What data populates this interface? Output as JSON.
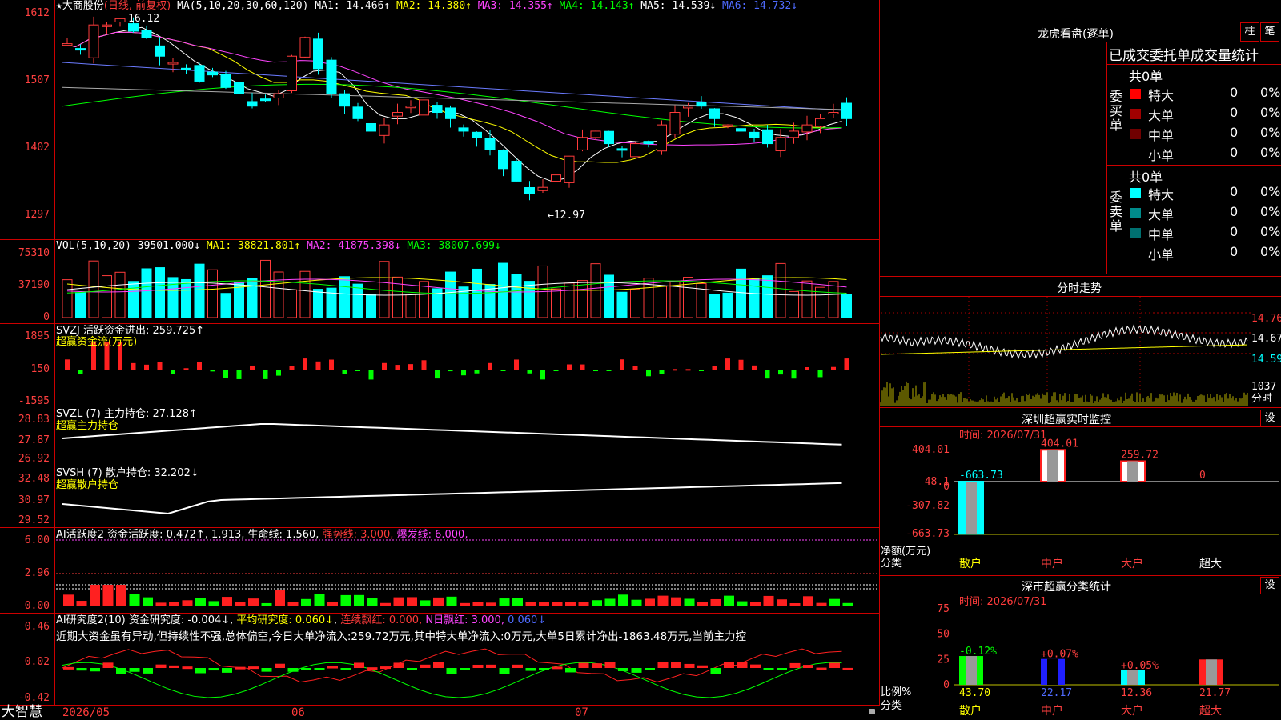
{
  "header": {
    "star": "★",
    "stock_name": "大商股份",
    "period": "(日线, 前复权)",
    "ma_label": "MA(5,10,20,30,60,120)",
    "ma1": "MA1: 14.466↑",
    "ma2": "MA2: 14.380↑",
    "ma3": "MA3: 14.355↑",
    "ma4": "MA4: 14.143↑",
    "ma5": "MA5: 14.539↓",
    "ma6": "MA6: 14.732↓",
    "max_price_label": "16.12",
    "min_price_label": "←12.97"
  },
  "price_axis": [
    "1612",
    "1507",
    "1402",
    "1297"
  ],
  "vol": {
    "label": "VOL(5,10,20)",
    "value": "39501.000↓",
    "ma1": "MA1: 38821.801↑",
    "ma2": "MA2: 41875.398↓",
    "ma3": "MA3: 38007.699↓",
    "axis": [
      "75310",
      "37190",
      "0"
    ]
  },
  "svzj": {
    "label": "SVZJ  活跃资金进出: 259.725↑",
    "sub": "超赢资金流(万元)",
    "axis": [
      "1895",
      "150",
      "-1595"
    ]
  },
  "svzl": {
    "label": "SVZL (7) 主力持仓: 27.128↑",
    "sub": "超赢主力持仓",
    "axis": [
      "28.83",
      "27.87",
      "26.92"
    ]
  },
  "svsh": {
    "label": "SVSH (7) 散户持仓: 32.202↓",
    "sub": "超赢散户持仓",
    "axis": [
      "32.48",
      "30.97",
      "29.52"
    ]
  },
  "ai_active": {
    "label": "AI活跃度2 资金活跃度: 0.472↑",
    "v2": "1.913",
    "life": "生命线: 1.560",
    "strong": "强势线: 3.000",
    "burst": "爆发线: 6.000",
    "axis": [
      "6.00",
      "2.96",
      "0.00"
    ]
  },
  "ai_research": {
    "label": "AI研究度2(10) 资金研究度: -0.004↓",
    "avg": "平均研究度: 0.060↓",
    "red_days": "连续飘红: 0.000",
    "n_red": "N日飘红: 3.000",
    "extra": "0.060↓",
    "comment": "近期大资金虽有异动,但持续性不强,总体偏空,今日大单净流入:259.72万元,其中特大单净流入:0万元,大单5日累计净出-1863.48万元,当前主力控",
    "axis": [
      "0.46",
      "0.02",
      "-0.42"
    ]
  },
  "date_axis": [
    "2026/05",
    "06",
    "07"
  ],
  "brand": "大智慧",
  "right": {
    "lhb_title": "龙虎看盘(逐单)",
    "btn_zhu": "柱",
    "btn_bi": "笔",
    "stats_title": "已成交委托单成交量统计",
    "buy_total": "共0单",
    "sell_total": "共0单",
    "buy_side": "委买单",
    "sell_side": "委卖单",
    "buy_rows": [
      {
        "name": "特大",
        "count": "0",
        "pct": "0%",
        "color": "#ff0000"
      },
      {
        "name": "大单",
        "count": "0",
        "pct": "0%",
        "color": "#a00000"
      },
      {
        "name": "中单",
        "count": "0",
        "pct": "0%",
        "color": "#700000"
      },
      {
        "name": "小单",
        "count": "0",
        "pct": "0%",
        "color": ""
      }
    ],
    "sell_rows": [
      {
        "name": "特大",
        "count": "0",
        "pct": "0%",
        "color": "#00ffff"
      },
      {
        "name": "大单",
        "count": "0",
        "pct": "0%",
        "color": "#008b8b"
      },
      {
        "name": "中单",
        "count": "0",
        "pct": "0%",
        "color": "#007070"
      },
      {
        "name": "小单",
        "count": "0",
        "pct": "0%",
        "color": ""
      }
    ],
    "intraday_title": "分时走势",
    "intraday_axis": [
      "14.76",
      "14.67",
      "14.59"
    ],
    "intraday_vol": "1037",
    "intraday_vol_label": "分时",
    "monitor_title": "深圳超赢实时监控",
    "monitor_btn": "设",
    "monitor_time": "时间: 2026/07/31",
    "monitor_axis": [
      "404.01",
      "48.1",
      "0",
      "-307.82",
      "-663.73"
    ],
    "monitor_values": [
      "-663.73",
      "404.01",
      "259.72",
      "0"
    ],
    "monitor_ylabel": "净额(万元)",
    "monitor_xlabel": "分类",
    "monitor_cats": [
      "散户",
      "中户",
      "大户",
      "超大"
    ],
    "classify_title": "深市超赢分类统计",
    "classify_btn": "设",
    "classify_time": "时间: 2026/07/31",
    "classify_axis": [
      "75",
      "50",
      "25",
      "0"
    ],
    "classify_changes": [
      "-0.12%",
      "+0.07%",
      "+0.05%"
    ],
    "classify_values": [
      "43.70",
      "22.17",
      "12.36",
      "21.77"
    ],
    "classify_ylabel": "比例%",
    "classify_xlabel": "分类",
    "classify_cats": [
      "散户",
      "中户",
      "大户",
      "超大"
    ]
  }
}
